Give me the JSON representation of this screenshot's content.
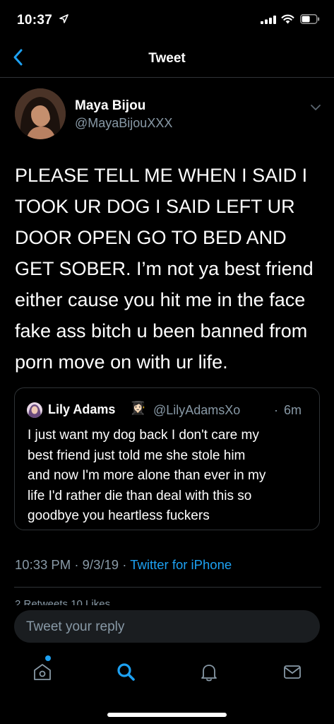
{
  "status_bar": {
    "time": "10:37"
  },
  "nav": {
    "title": "Tweet"
  },
  "tweet": {
    "display_name": "Maya Bijou",
    "handle": "@MayaBijouXXX",
    "lines": [
      "PLEASE TELL ME WHEN I SAID I",
      "TOOK UR DOG I SAID LEFT UR",
      "DOOR OPEN GO TO BED AND",
      "GET SOBER. I’m not ya best friend",
      "either cause you hit me in the face",
      "fake ass bitch u been banned from",
      "porn move on with ur life."
    ],
    "timestamp": "10:33 PM",
    "separator": "·",
    "date": "9/3/19",
    "source": "Twitter for iPhone"
  },
  "quote": {
    "display_name": "Lily Adams",
    "emoji": "👩🏻‍🎓",
    "handle": "@LilyAdamsXo",
    "dot": "·",
    "time": "6m",
    "lines": [
      "I just want my dog back I don't care my",
      "best friend just told me she stole him",
      "and now I'm more alone than ever in my",
      "life I'd rather die than deal with this so",
      "goodbye you heartless fuckers"
    ]
  },
  "stats_peek": "2 Retweets   10 Likes",
  "reply": {
    "placeholder": "Tweet your reply"
  },
  "colors": {
    "accent": "#1da1f2",
    "secondary_text": "#8899a6",
    "background": "#000000",
    "divider": "#2f3336"
  },
  "tab_bar": {
    "icons": [
      "home-icon",
      "search-icon",
      "notifications-bell-icon",
      "messages-envelope-icon"
    ],
    "active": "search-icon"
  }
}
